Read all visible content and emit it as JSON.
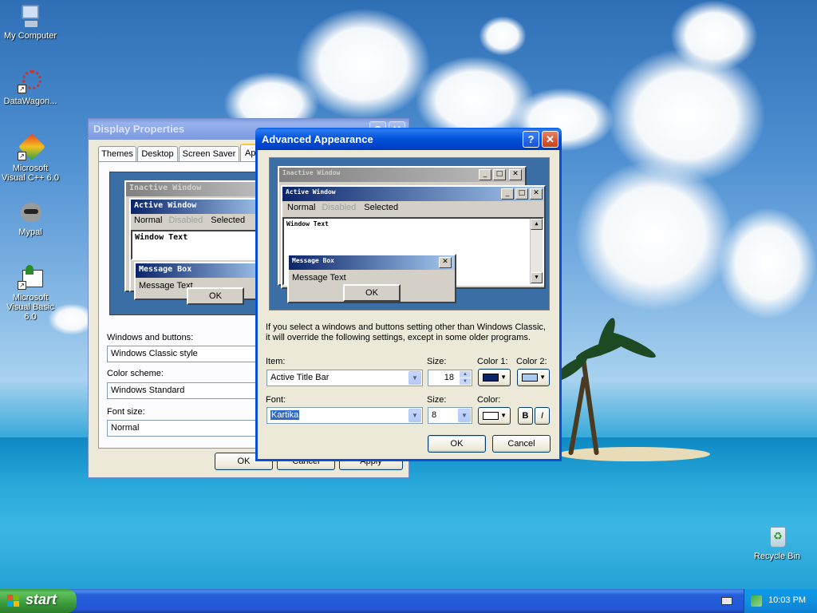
{
  "desktop": {
    "icons": [
      {
        "label": "My Computer"
      },
      {
        "label": "DataWagon..."
      },
      {
        "label": "Microsoft Visual C++ 6.0"
      },
      {
        "label": "Mypal"
      },
      {
        "label": "Microsoft Visual Basic 6.0"
      },
      {
        "label": "Recycle Bin"
      }
    ]
  },
  "display_properties": {
    "title": "Display Properties",
    "tabs": [
      "Themes",
      "Desktop",
      "Screen Saver",
      "Ap"
    ],
    "preview": {
      "inactive_title": "Inactive Window",
      "active_title": "Active Window",
      "menu": [
        "Normal",
        "Disabled",
        "Selected"
      ],
      "window_text": "Window Text",
      "message_box_title": "Message Box",
      "message_text": "Message Text",
      "ok": "OK"
    },
    "windows_buttons_label": "Windows and buttons:",
    "windows_buttons_value": "Windows Classic style",
    "color_scheme_label": "Color scheme:",
    "color_scheme_value": "Windows Standard",
    "font_size_label": "Font size:",
    "font_size_value": "Normal",
    "buttons": {
      "ok": "OK",
      "cancel": "Cancel",
      "apply": "Apply"
    }
  },
  "advanced_appearance": {
    "title": "Advanced Appearance",
    "preview": {
      "inactive_title": "Inactive Window",
      "active_title": "Active Window",
      "menu": [
        "Normal",
        "Disabled",
        "Selected"
      ],
      "window_text": "Window Text",
      "message_box_title": "Message Box",
      "message_text": "Message Text",
      "ok": "OK"
    },
    "info_text_line1": "If you select a windows and buttons setting other than Windows Classic,",
    "info_text_line2": "it will override the following settings, except in some older programs.",
    "item_label": "Item:",
    "item_value": "Active Title Bar",
    "item_size_label": "Size:",
    "item_size_value": "18",
    "color1_label": "Color 1:",
    "color2_label": "Color 2:",
    "color1": "#0a246a",
    "color2": "#a6caf0",
    "font_label": "Font:",
    "font_value": "Kartika",
    "font_size_label": "Size:",
    "font_size_value": "8",
    "font_color_label": "Color:",
    "font_color": "#ffffff",
    "bold_label": "B",
    "italic_label": "I",
    "ok": "OK",
    "cancel": "Cancel"
  },
  "taskbar": {
    "start_label": "start",
    "clock": "10:03 PM"
  }
}
